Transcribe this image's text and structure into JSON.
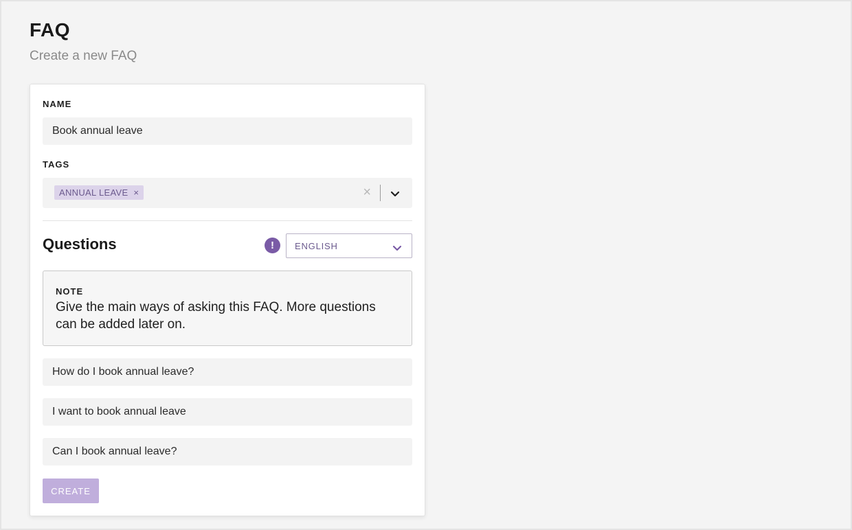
{
  "page": {
    "title": "FAQ",
    "subtitle": "Create a new FAQ"
  },
  "form": {
    "name_label": "NAME",
    "name_value": "Book annual leave",
    "tags_label": "TAGS",
    "tags": [
      "ANNUAL LEAVE"
    ],
    "tag_remove_glyph": "×",
    "tags_clear_glyph": "×"
  },
  "questions": {
    "section_title": "Questions",
    "alert_glyph": "!",
    "language": "ENGLISH",
    "note_label": "NOTE",
    "note_text": "Give the main ways of asking this FAQ. More questions can be added later on.",
    "items": [
      "How do I book annual leave?",
      "I want to book annual leave",
      "Can I book annual leave?"
    ]
  },
  "actions": {
    "create_label": "CREATE"
  },
  "colors": {
    "accent": "#7a5ba6",
    "tag_background": "#dcd3ea",
    "button_disabled": "#c0aedc",
    "field_background": "#f3f3f3"
  },
  "icons": {
    "alert": "exclamation-circle-icon",
    "dropdown": "chevron-down-icon",
    "remove": "close-icon"
  }
}
